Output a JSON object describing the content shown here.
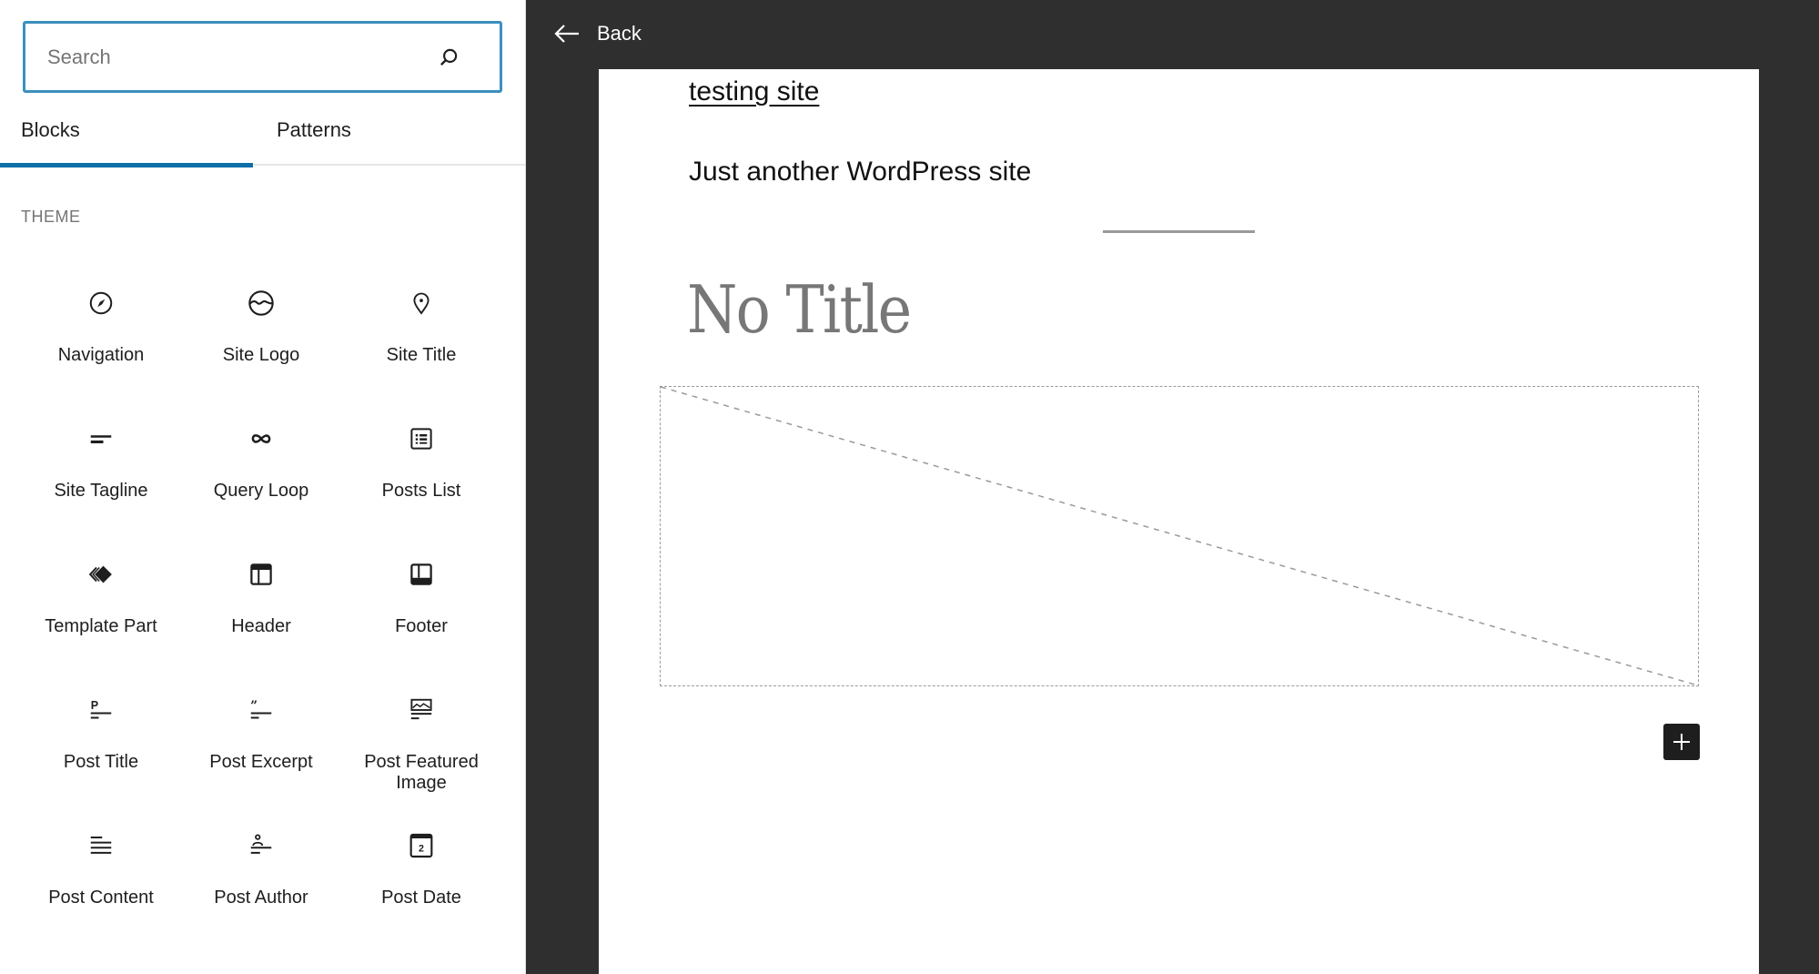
{
  "sidebar": {
    "search": {
      "placeholder": "Search",
      "value": "",
      "icon": "search-icon"
    },
    "tabs": [
      {
        "label": "Blocks",
        "active": true
      },
      {
        "label": "Patterns",
        "active": false
      }
    ],
    "category": "THEME",
    "blocks": [
      {
        "label": "Navigation",
        "icon": "navigation-icon"
      },
      {
        "label": "Site Logo",
        "icon": "site-logo-icon"
      },
      {
        "label": "Site Title",
        "icon": "map-marker-icon"
      },
      {
        "label": "Site Tagline",
        "icon": "site-tagline-icon"
      },
      {
        "label": "Query Loop",
        "icon": "loop-icon"
      },
      {
        "label": "Posts List",
        "icon": "posts-list-icon"
      },
      {
        "label": "Template Part",
        "icon": "template-part-icon"
      },
      {
        "label": "Header",
        "icon": "header-icon"
      },
      {
        "label": "Footer",
        "icon": "footer-icon"
      },
      {
        "label": "Post Title",
        "icon": "post-title-icon"
      },
      {
        "label": "Post Excerpt",
        "icon": "post-excerpt-icon"
      },
      {
        "label": "Post Featured Image",
        "icon": "post-featured-image-icon"
      },
      {
        "label": "Post Content",
        "icon": "post-content-icon"
      },
      {
        "label": "Post Author",
        "icon": "post-author-icon"
      },
      {
        "label": "Post Date",
        "icon": "post-date-icon"
      }
    ]
  },
  "editor": {
    "back_label": "Back",
    "canvas": {
      "site_title": "testing site",
      "site_tagline": "Just another WordPress site",
      "post_title": "No Title",
      "inserter_label": "+"
    },
    "date_icon_day": "2"
  },
  "colors": {
    "accent": "#0f6fa8",
    "focus_border": "#3c8fbf",
    "editor_bg": "#2f2f2f"
  }
}
